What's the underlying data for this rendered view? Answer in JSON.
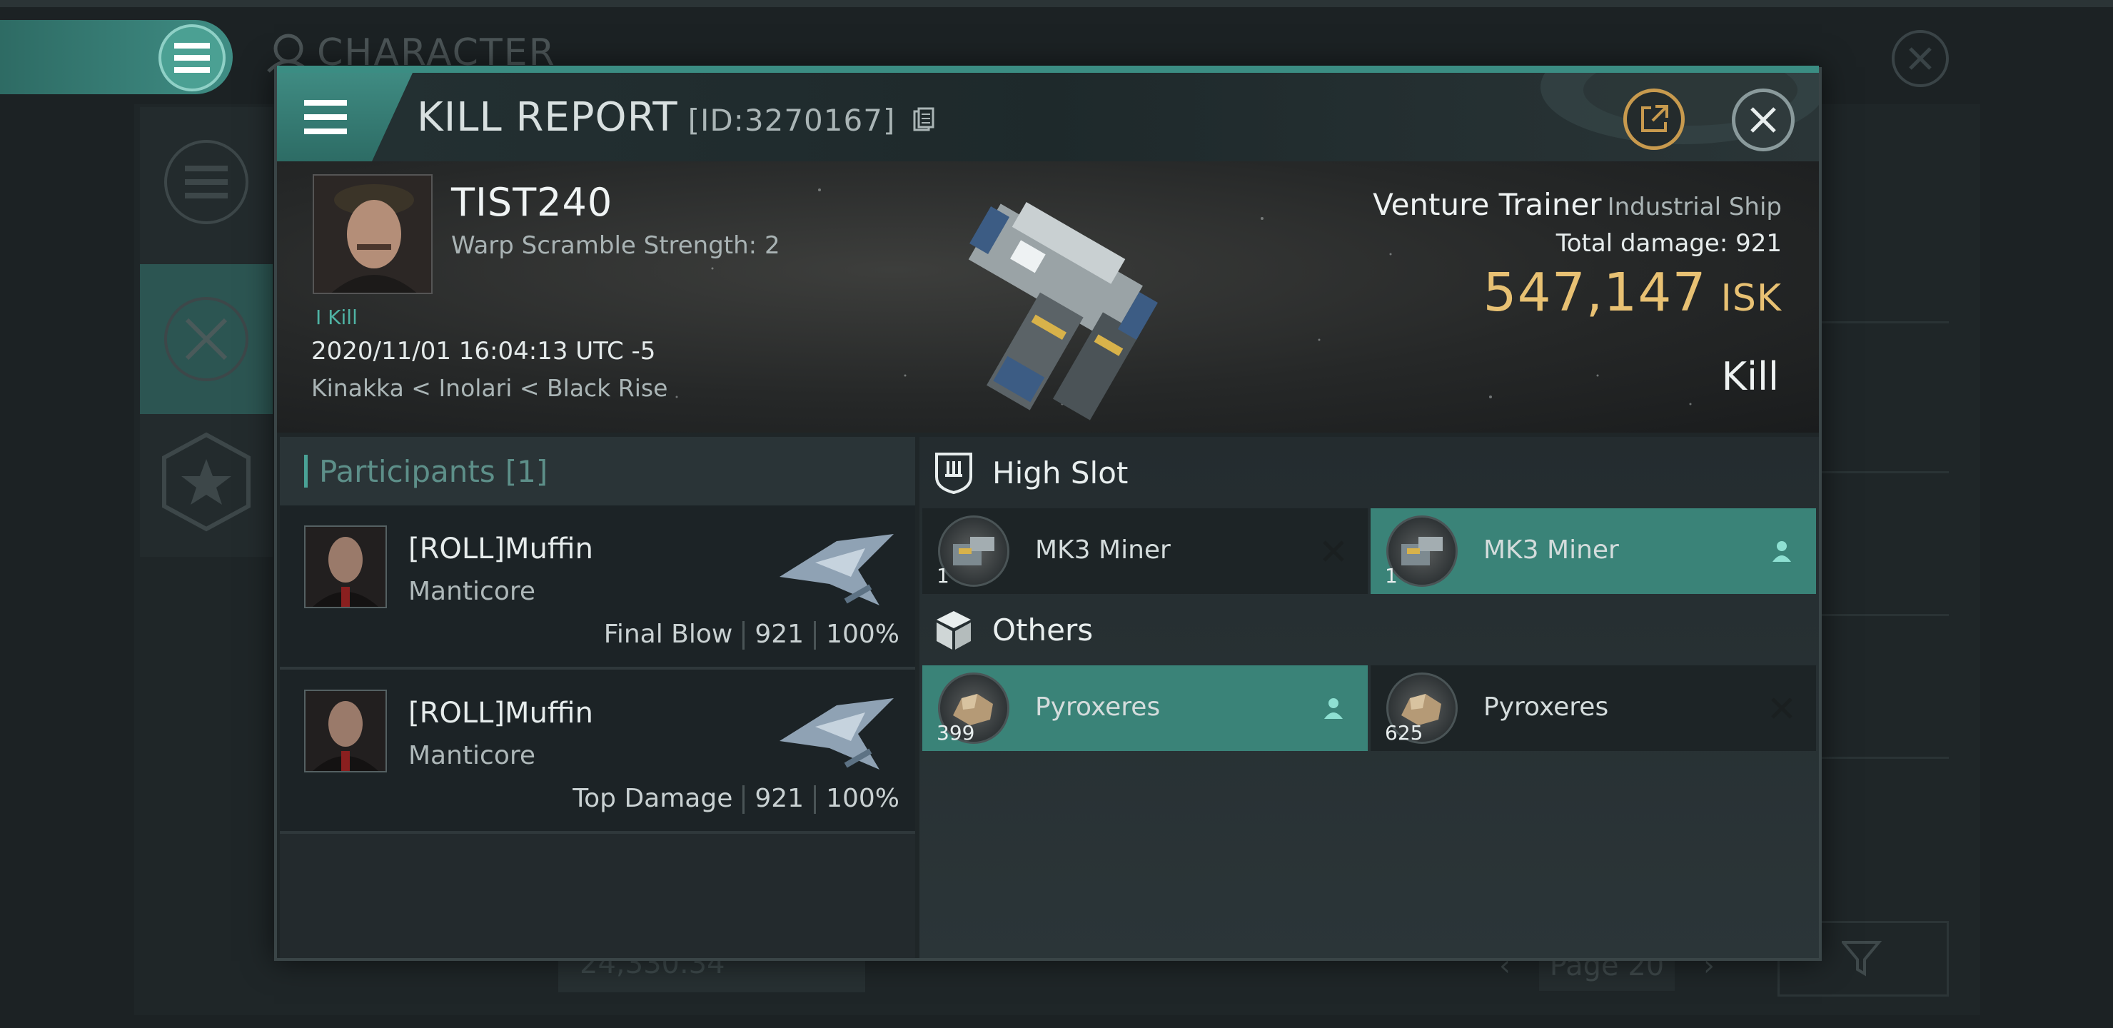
{
  "background": {
    "title": "CHARACTER",
    "balance": "24,330.34",
    "pager_label": "Page 20"
  },
  "modal": {
    "title": "KILL REPORT",
    "report_id": "[ID:3270167]"
  },
  "victim": {
    "name": "TIST240",
    "warp_scramble": "Warp Scramble Strength: 2",
    "kill_count": "I Kill",
    "datetime": "2020/11/01 16:04:13 UTC -5",
    "location": "Kinakka < Inolari < Black Rise",
    "ship_name": "Venture Trainer",
    "ship_class": "Industrial Ship",
    "total_damage_label": "Total damage:",
    "total_damage": "921",
    "isk_value": "547,147",
    "isk_unit": "ISK",
    "result": "Kill"
  },
  "participants": {
    "header_label": "Participants",
    "header_count": "[1]",
    "rows": [
      {
        "name": "[ROLL]Muffin",
        "ship": "Manticore",
        "role": "Final Blow",
        "damage": "921",
        "percent": "100%"
      },
      {
        "name": "[ROLL]Muffin",
        "ship": "Manticore",
        "role": "Top Damage",
        "damage": "921",
        "percent": "100%"
      }
    ]
  },
  "fittings": {
    "high_slot_label": "High Slot",
    "high_slot": [
      {
        "name": "MK3 Miner",
        "qty": "1",
        "status": "destroyed"
      },
      {
        "name": "MK3 Miner",
        "qty": "1",
        "status": "dropped"
      }
    ],
    "others_label": "Others",
    "others": [
      {
        "name": "Pyroxeres",
        "qty": "399",
        "status": "dropped"
      },
      {
        "name": "Pyroxeres",
        "qty": "625",
        "status": "destroyed"
      }
    ]
  },
  "colors": {
    "accent_teal": "#3f8b82",
    "isk_gold": "#e8c173",
    "dropped_highlight": "#3a8378"
  }
}
